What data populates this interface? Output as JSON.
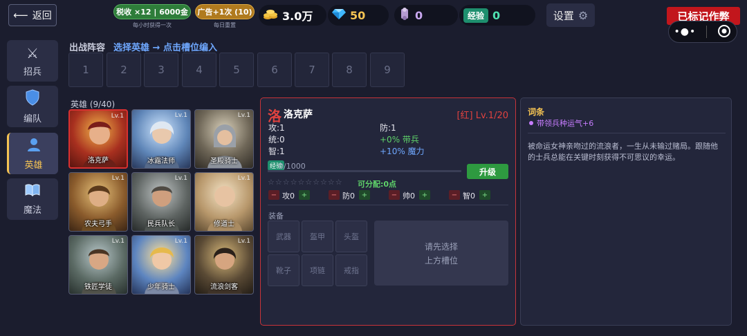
{
  "topbar": {
    "back_label": "返回",
    "tax_badge": "税收 ×12 | 6000金",
    "tax_note": "每小时获得一次",
    "ad_badge": "广告+1次 (10)",
    "ad_note": "每日重置",
    "gold_value": "3.0万",
    "diamond_value": "50",
    "scroll_value": "0",
    "exp_label": "经验",
    "exp_value": "0",
    "settings_label": "设置",
    "marked_label": "已标记作弊"
  },
  "sidebar": {
    "items": [
      {
        "label": "招兵",
        "icon": "crossed-swords-icon"
      },
      {
        "label": "编队",
        "icon": "shield-icon"
      },
      {
        "label": "英雄",
        "icon": "person-icon"
      },
      {
        "label": "魔法",
        "icon": "book-icon"
      }
    ],
    "active": "英雄"
  },
  "lineup": {
    "title": "出战阵容",
    "hint": "选择英雄 → 点击槽位编入",
    "slots": [
      "1",
      "2",
      "3",
      "4",
      "5",
      "6",
      "7",
      "8",
      "9"
    ]
  },
  "heroes": {
    "title": "英雄 (9/40)",
    "list": [
      {
        "name": "洛克萨",
        "level": "Lv.1",
        "selected": true
      },
      {
        "name": "冰霜法师",
        "level": "Lv.1"
      },
      {
        "name": "圣殿骑士",
        "level": "Lv.1"
      },
      {
        "name": "农夫弓手",
        "level": "Lv.1"
      },
      {
        "name": "民兵队长",
        "level": "Lv.1"
      },
      {
        "name": "修道士",
        "level": "Lv.1"
      },
      {
        "name": "铁匠学徒",
        "level": "Lv.1"
      },
      {
        "name": "少年骑士",
        "level": "Lv.1"
      },
      {
        "name": "流浪剑客",
        "level": "Lv.1"
      }
    ]
  },
  "detail": {
    "glyph": "洛",
    "name": "洛克萨",
    "rarity_level": "[红] Lv.1/20",
    "stats": {
      "atk": "攻:1",
      "def": "防:1",
      "lead": "统:0",
      "bonus_troop": "+0% 带兵",
      "int": "智:1",
      "bonus_magic": "+10% 魔力"
    },
    "exp_tag": "经验",
    "exp_text": "0/1000",
    "exp_progress": 0,
    "upgrade_label": "升级",
    "stars": "☆☆☆☆☆☆☆☆☆☆",
    "allocatable": "可分配:0点",
    "alloc": [
      {
        "label": "攻0"
      },
      {
        "label": "防0"
      },
      {
        "label": "帅0"
      },
      {
        "label": "智0"
      }
    ],
    "equip_title": "装备",
    "equip_slots": [
      "武器",
      "盔甲",
      "头盔",
      "靴子",
      "项链",
      "戒指"
    ],
    "equip_hint_1": "请先选择",
    "equip_hint_2": "上方槽位"
  },
  "traits": {
    "title": "词条",
    "item": "带领兵种运气+6",
    "description": "被命运女神亲吻过的流浪者，一生从未输过赌局。跟随他的士兵总能在关键时刻获得不可思议的幸运。"
  },
  "colors": {
    "background": "#1b1d2e",
    "accent_red": "#c8343a",
    "accent_gold": "#f6c453",
    "accent_blue": "#6fa8ff",
    "accent_green": "#5fd36a",
    "trait_purple": "#c77dff"
  }
}
